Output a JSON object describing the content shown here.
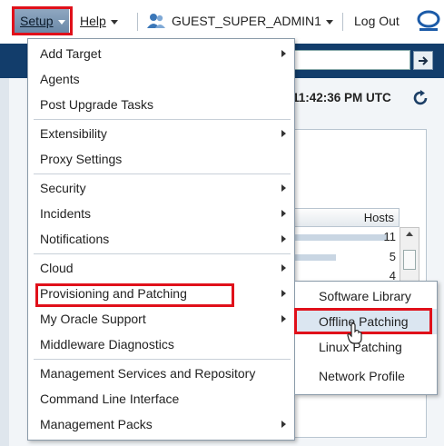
{
  "topbar": {
    "setup_label": "Setup",
    "help_label": "Help",
    "user_label": "GUEST_SUPER_ADMIN1",
    "logout_label": "Log Out"
  },
  "header": {
    "time": "11:42:36 PM UTC"
  },
  "hosts": {
    "header": "Hosts",
    "values": [
      "11",
      "5",
      "4"
    ]
  },
  "setup_menu": {
    "items": [
      {
        "label": "Add Target",
        "submenu": true
      },
      {
        "label": "Agents",
        "submenu": false
      },
      {
        "label": "Post Upgrade Tasks",
        "submenu": false
      },
      {
        "label": "Extensibility",
        "submenu": true
      },
      {
        "label": "Proxy Settings",
        "submenu": false
      },
      {
        "label": "Security",
        "submenu": true
      },
      {
        "label": "Incidents",
        "submenu": true
      },
      {
        "label": "Notifications",
        "submenu": true
      },
      {
        "label": "Cloud",
        "submenu": true
      },
      {
        "label": "Provisioning and Patching",
        "submenu": true
      },
      {
        "label": "My Oracle Support",
        "submenu": true
      },
      {
        "label": "Middleware Diagnostics",
        "submenu": false
      },
      {
        "label": "Management Services and Repository",
        "submenu": false
      },
      {
        "label": "Command Line Interface",
        "submenu": false
      },
      {
        "label": "Management Packs",
        "submenu": true
      }
    ]
  },
  "provisioning_submenu": {
    "items": [
      {
        "label": "Software Library"
      },
      {
        "label": "Offline Patching"
      },
      {
        "label": "Linux Patching"
      },
      {
        "label": "Network Profile"
      }
    ]
  },
  "colors": {
    "highlight_red": "#e0101a",
    "band_blue": "#123d6b",
    "hover_blue": "#dbe6f1"
  }
}
